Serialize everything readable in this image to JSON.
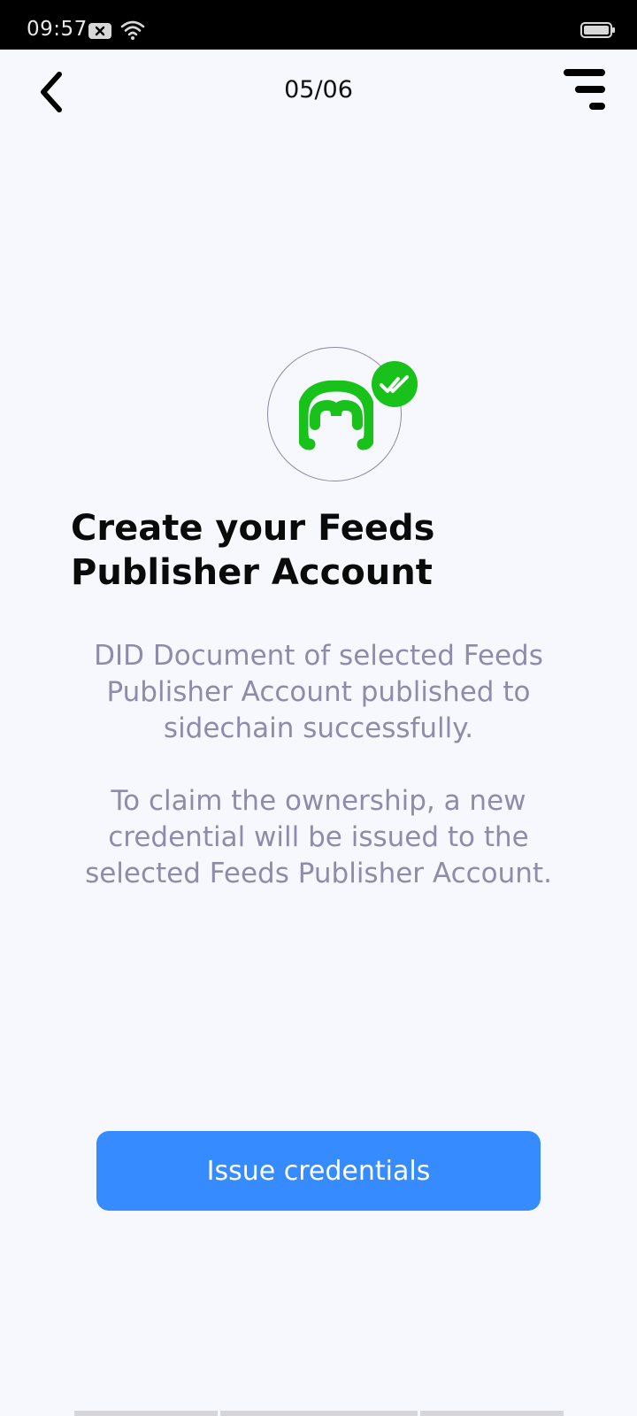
{
  "status_bar": {
    "time": "09:57"
  },
  "header": {
    "page_counter": "05/06"
  },
  "main": {
    "title": "Create your Feeds Publisher Account",
    "description": "DID Document of selected Feeds Publisher Account published to sidechain successfully.\n\nTo claim the ownership, a new credential will be issued to the selected Feeds Publisher Account."
  },
  "actions": {
    "issue_label": "Issue credentials"
  },
  "colors": {
    "accent": "#368bff",
    "success": "#18c21b",
    "muted_text": "#8e8cab",
    "background": "#f7f8fd"
  },
  "icons": {
    "back": "chevron-left-icon",
    "menu": "menu-lines-icon",
    "logo": "feeds-logo-icon",
    "badge": "double-check-icon",
    "wifi": "wifi-icon",
    "battery": "battery-icon",
    "notification": "notification-icon"
  }
}
